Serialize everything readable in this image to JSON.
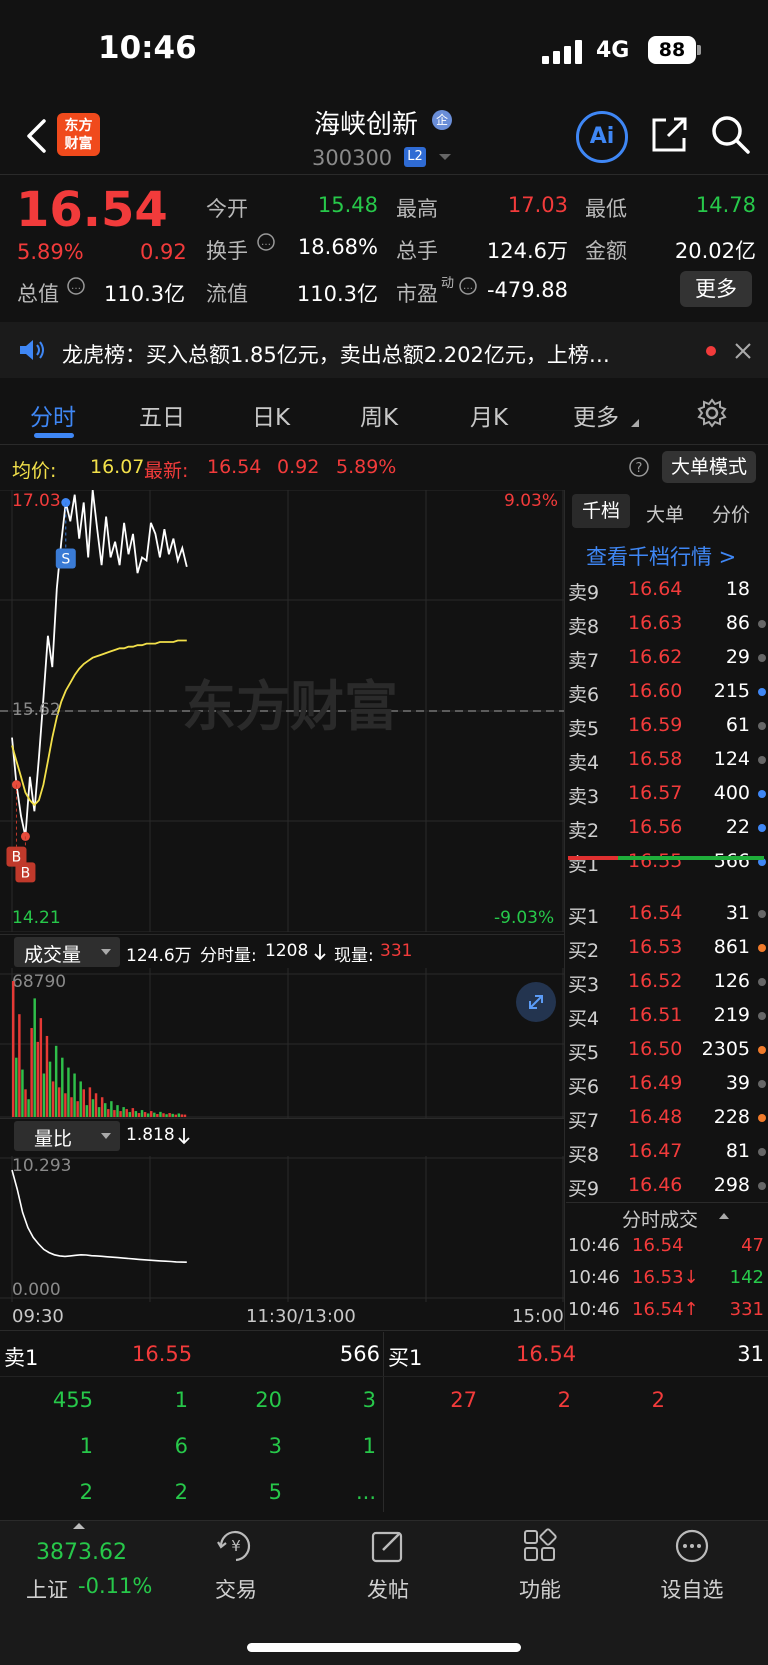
{
  "status_bar": {
    "time": "10:46",
    "network": "4G",
    "battery": "88"
  },
  "header": {
    "logo_line1": "东方",
    "logo_line2": "财富",
    "stock_name": "海峡创新",
    "name_badge": "企",
    "stock_code": "300300",
    "level_badge": "L2",
    "ai_label": "Ai"
  },
  "quote": {
    "last_price": "16.54",
    "change_pct": "5.89%",
    "change_amt": "0.92",
    "total_cap_label": "总值",
    "total_cap": "110.3亿",
    "open_label": "今开",
    "open": "15.48",
    "high_label": "最高",
    "high": "17.03",
    "low_label": "最低",
    "low": "14.78",
    "turnover_label": "换手",
    "turnover": "18.68%",
    "volume_label": "总手",
    "volume": "124.6万",
    "amount_label": "金额",
    "amount": "20.02亿",
    "float_cap_label": "流值",
    "float_cap": "110.3亿",
    "pe_label": "市盈",
    "pe_sup": "动",
    "pe": "-479.88",
    "more_label": "更多"
  },
  "news": {
    "text": "龙虎榜：买入总额1.85亿元，卖出总额2.202亿元，上榜…"
  },
  "tabs": [
    "分时",
    "五日",
    "日K",
    "周K",
    "月K",
    "更多"
  ],
  "chart_header": {
    "avg_label": "均价:",
    "avg_value": "16.07",
    "latest_label": "最新:",
    "latest_value": "16.54",
    "latest_change": "0.92",
    "latest_pct": "5.89%",
    "big_order_label": "大单模式"
  },
  "intraday": {
    "price_top": "17.03",
    "price_mid": "15.62",
    "price_bottom": "14.21",
    "pct_top": "9.03%",
    "pct_bottom": "-9.03%",
    "watermark": "东方财富",
    "markers": [
      "S",
      "B",
      "B"
    ],
    "time_start": "09:30",
    "time_mid": "11:30/13:00",
    "time_end": "15:00"
  },
  "volume_panel": {
    "dropdown_label": "成交量",
    "total": "124.6万",
    "minute_label": "分时量:",
    "minute_value": "1208",
    "current_label": "现量:",
    "current_value": "331",
    "max": "68790"
  },
  "ratio_panel": {
    "dropdown_label": "量比",
    "value": "1.818",
    "max": "10.293",
    "min": "0.000"
  },
  "order_book": {
    "tabs": [
      "千档",
      "大单",
      "分价"
    ],
    "link": "查看千档行情 >",
    "asks": [
      {
        "label": "卖9",
        "price": "16.64",
        "vol": "18",
        "dot": ""
      },
      {
        "label": "卖8",
        "price": "16.63",
        "vol": "86",
        "dot": "gray"
      },
      {
        "label": "卖7",
        "price": "16.62",
        "vol": "29",
        "dot": "gray"
      },
      {
        "label": "卖6",
        "price": "16.60",
        "vol": "215",
        "dot": "blue"
      },
      {
        "label": "卖5",
        "price": "16.59",
        "vol": "61",
        "dot": "gray"
      },
      {
        "label": "卖4",
        "price": "16.58",
        "vol": "124",
        "dot": "gray"
      },
      {
        "label": "卖3",
        "price": "16.57",
        "vol": "400",
        "dot": "blue"
      },
      {
        "label": "卖2",
        "price": "16.56",
        "vol": "22",
        "dot": "blue"
      },
      {
        "label": "卖1",
        "price": "16.55",
        "vol": "566",
        "dot": "blue"
      }
    ],
    "bids": [
      {
        "label": "买1",
        "price": "16.54",
        "vol": "31",
        "dot": "gray"
      },
      {
        "label": "买2",
        "price": "16.53",
        "vol": "861",
        "dot": "orange"
      },
      {
        "label": "买3",
        "price": "16.52",
        "vol": "126",
        "dot": "gray"
      },
      {
        "label": "买4",
        "price": "16.51",
        "vol": "219",
        "dot": "gray"
      },
      {
        "label": "买5",
        "price": "16.50",
        "vol": "2305",
        "dot": "orange"
      },
      {
        "label": "买6",
        "price": "16.49",
        "vol": "39",
        "dot": "gray"
      },
      {
        "label": "买7",
        "price": "16.48",
        "vol": "228",
        "dot": "orange"
      },
      {
        "label": "买8",
        "price": "16.47",
        "vol": "81",
        "dot": "gray"
      },
      {
        "label": "买9",
        "price": "16.46",
        "vol": "298",
        "dot": "gray"
      }
    ],
    "ticks_title": "分时成交",
    "ticks": [
      {
        "time": "10:46",
        "price": "16.54",
        "vol": "47",
        "price_color": "red",
        "vol_color": "red"
      },
      {
        "time": "10:46",
        "price": "16.53↓",
        "vol": "142",
        "price_color": "red",
        "vol_color": "green"
      },
      {
        "time": "10:46",
        "price": "16.54↑",
        "vol": "331",
        "price_color": "red",
        "vol_color": "red"
      }
    ]
  },
  "depth": {
    "ask_label": "卖1",
    "ask_price": "16.55",
    "ask_vol": "566",
    "bid_label": "买1",
    "bid_price": "16.54",
    "bid_vol": "31",
    "ask_queue": [
      [
        "455",
        "1",
        "20",
        "3"
      ],
      [
        "1",
        "6",
        "3",
        "1"
      ],
      [
        "2",
        "2",
        "5",
        "..."
      ]
    ],
    "bid_queue": [
      [
        "27",
        "2",
        "2"
      ]
    ]
  },
  "bottom_nav": {
    "index_value": "3873.62",
    "index_name": "上证",
    "index_change": "-0.11%",
    "items": [
      "交易",
      "发帖",
      "功能",
      "设自选"
    ]
  },
  "chart_data": {
    "type": "line",
    "title": "",
    "ylim": [
      14.21,
      17.03
    ],
    "reference_price": 15.62,
    "series": [
      {
        "name": "",
        "color": "#ffffff",
        "values": [
          15.45,
          15.15,
          14.95,
          14.82,
          15.2,
          14.98,
          15.32,
          15.7,
          16.1,
          15.9,
          16.4,
          16.7,
          16.95,
          16.83,
          17.0,
          16.72,
          16.95,
          16.6,
          17.03,
          16.78,
          16.55,
          16.86,
          16.6,
          16.7,
          16.55,
          16.82,
          16.62,
          16.75,
          16.5,
          16.6,
          16.58,
          16.82,
          16.75,
          16.6,
          16.78,
          16.62,
          16.72,
          16.58,
          16.66,
          16.54
        ]
      },
      {
        "name": "",
        "color": "#f2e04a",
        "values": [
          15.4,
          15.3,
          15.2,
          15.1,
          15.05,
          15.02,
          15.05,
          15.15,
          15.3,
          15.45,
          15.58,
          15.68,
          15.75,
          15.8,
          15.85,
          15.89,
          15.92,
          15.94,
          15.96,
          15.97,
          15.98,
          15.99,
          16.0,
          16.01,
          16.02,
          16.02,
          16.03,
          16.03,
          16.04,
          16.04,
          16.05,
          16.05,
          16.05,
          16.06,
          16.06,
          16.06,
          16.06,
          16.07,
          16.07,
          16.07
        ]
      }
    ],
    "volume": {
      "ylim": [
        0,
        68790
      ],
      "values": [
        68790,
        30000,
        52000,
        24000,
        14000,
        9000,
        45000,
        60000,
        38000,
        50000,
        22000,
        41000,
        28000,
        18000,
        36000,
        15000,
        30000,
        12000,
        25000,
        10000,
        22000,
        8000,
        18000,
        14000,
        6000,
        15000,
        9000,
        12000,
        5000,
        10000,
        7000,
        4000,
        8000,
        3500,
        6000,
        3000,
        5000,
        4000,
        2500,
        4500,
        3000,
        2000,
        3500,
        2500,
        1800,
        3000,
        2200,
        1500,
        2600,
        1900,
        1400,
        2000,
        1600,
        1200,
        1800,
        1300,
        1208
      ],
      "colors": [
        "r",
        "g",
        "r",
        "g",
        "r",
        "g",
        "r",
        "g",
        "r",
        "r",
        "g",
        "r",
        "g",
        "r",
        "g",
        "r",
        "g",
        "r",
        "g",
        "r",
        "g",
        "r",
        "g",
        "r",
        "g",
        "r",
        "g",
        "r",
        "g",
        "r",
        "g",
        "r",
        "g",
        "r",
        "g",
        "r",
        "g",
        "r",
        "g",
        "r",
        "g",
        "r",
        "g",
        "r",
        "g",
        "r",
        "g",
        "r",
        "g",
        "r",
        "g",
        "r",
        "g",
        "r",
        "g",
        "r",
        "r"
      ]
    },
    "volume_ratio": {
      "ylim": [
        0,
        10.293
      ],
      "values": [
        10.293,
        8.5,
        6.4,
        5.0,
        4.1,
        3.5,
        3.0,
        2.7,
        2.5,
        2.4,
        2.35,
        2.4,
        2.45,
        2.5,
        2.48,
        2.42,
        2.4,
        2.36,
        2.32,
        2.28,
        2.24,
        2.2,
        2.16,
        2.12,
        2.08,
        2.04,
        2.0,
        1.97,
        1.94,
        1.91,
        1.88,
        1.85,
        1.83,
        1.818
      ]
    }
  }
}
